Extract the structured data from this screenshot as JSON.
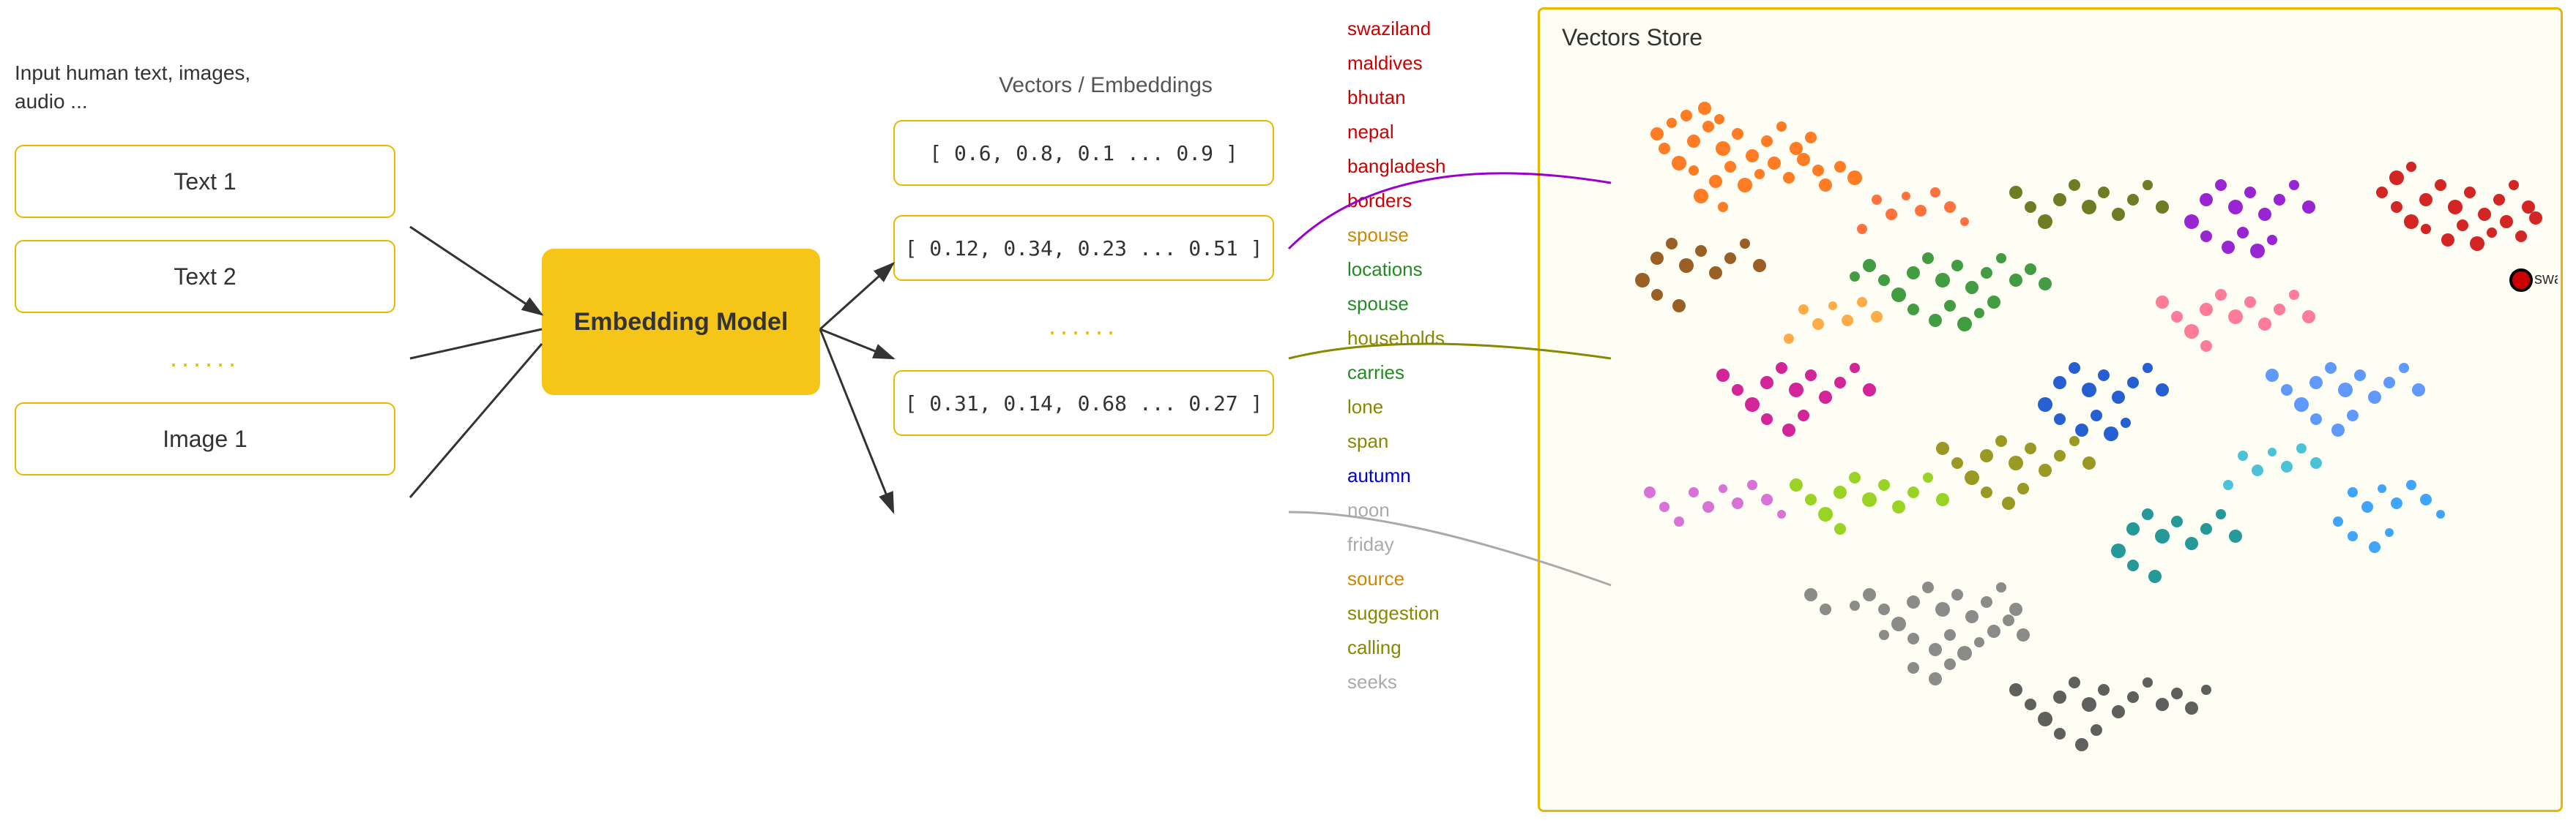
{
  "header": {
    "input_label": "Input human text, images,\naudio ...",
    "embedding_model_label": "Embedding Model",
    "vectors_label": "Vectors / Embeddings",
    "vectors_store_label": "Vectors Store"
  },
  "input_boxes": [
    {
      "label": "Text 1"
    },
    {
      "label": "Text 2"
    },
    {
      "label": "......",
      "type": "dots"
    },
    {
      "label": "Image 1"
    }
  ],
  "vector_boxes": [
    {
      "value": "[ 0.6, 0.8, 0.1 ... 0.9 ]"
    },
    {
      "value": "[ 0.12, 0.34, 0.23 ... 0.51 ]"
    },
    {
      "value": "......",
      "type": "dots"
    },
    {
      "value": "[ 0.31, 0.14, 0.68 ... 0.27 ]"
    }
  ],
  "words": [
    {
      "text": "swaziland",
      "color": "#cc0000"
    },
    {
      "text": "maldives",
      "color": "#cc0000"
    },
    {
      "text": "bhutan",
      "color": "#cc0000"
    },
    {
      "text": "nepal",
      "color": "#cc0000"
    },
    {
      "text": "bangladesh",
      "color": "#cc0000"
    },
    {
      "text": "borders",
      "color": "#cc0000"
    },
    {
      "text": "spouse",
      "color": "#cc8800"
    },
    {
      "text": "locations",
      "color": "#228b22"
    },
    {
      "text": "spouse",
      "color": "#228b22"
    },
    {
      "text": "households",
      "color": "#888800"
    },
    {
      "text": "carries",
      "color": "#228b22"
    },
    {
      "text": "lone",
      "color": "#888800"
    },
    {
      "text": "span",
      "color": "#888800"
    },
    {
      "text": "autumn",
      "color": "#0000cc"
    },
    {
      "text": "noon",
      "color": "#888888"
    },
    {
      "text": "friday",
      "color": "#888888"
    },
    {
      "text": "source",
      "color": "#cc8800"
    },
    {
      "text": "suggestion",
      "color": "#888800"
    },
    {
      "text": "calling",
      "color": "#888800"
    },
    {
      "text": "seeks",
      "color": "#aaaaaa"
    }
  ],
  "swaziland_store_label": "swaziland",
  "colors": {
    "gold": "#e6b800",
    "box_border": "#e6b800",
    "embedding_bg": "#f5c518"
  }
}
